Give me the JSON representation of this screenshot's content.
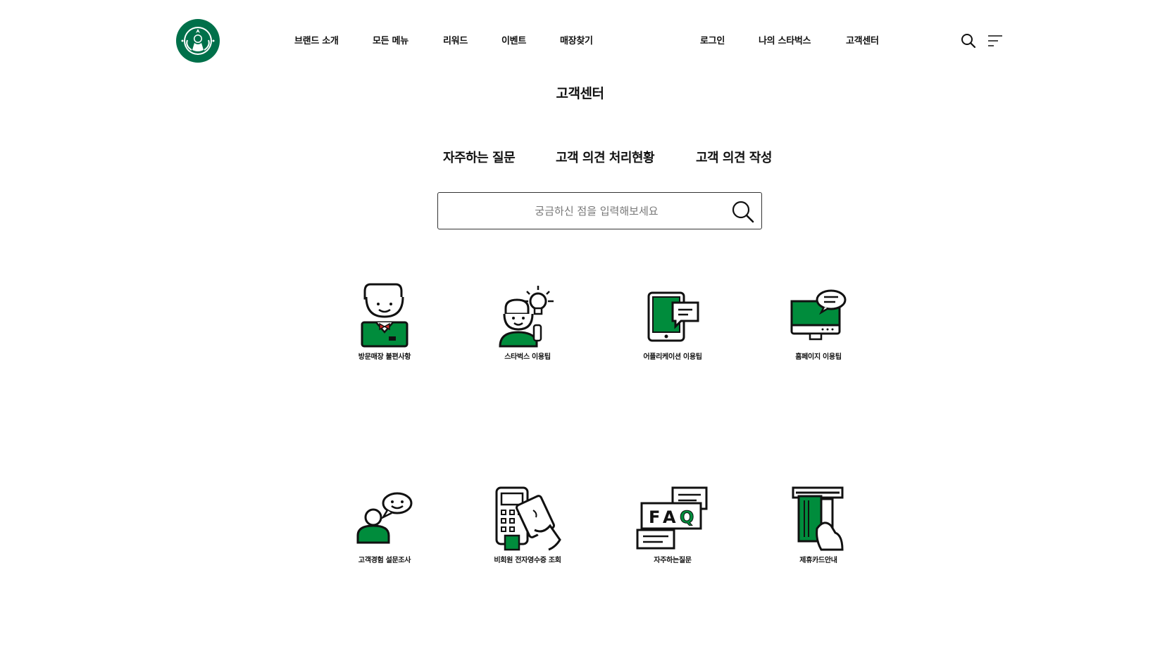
{
  "brand": {
    "logo_icon": "starbucks-siren-logo",
    "color": "#00704a"
  },
  "nav": {
    "left": [
      {
        "label": "브랜드 소개"
      },
      {
        "label": "모든 메뉴"
      },
      {
        "label": "리워드"
      },
      {
        "label": "이벤트"
      },
      {
        "label": "매장찾기"
      }
    ],
    "right": [
      {
        "label": "로그인"
      },
      {
        "label": "나의 스타벅스"
      },
      {
        "label": "고객센터"
      }
    ],
    "icons": [
      "search-icon",
      "menu-icon"
    ]
  },
  "page": {
    "title": "고객센터"
  },
  "tabs": [
    {
      "label": "자주하는 질문"
    },
    {
      "label": "고객 의견 처리현황"
    },
    {
      "label": "고객 의견 작성"
    }
  ],
  "search": {
    "placeholder": "궁금하신 점을 입력해보세요",
    "value": ""
  },
  "categories": [
    {
      "label": "방문매장 불편사항",
      "icon": "barista-icon"
    },
    {
      "label": "스타벅스 이용팁",
      "icon": "idea-barista-icon"
    },
    {
      "label": "어플리케이션 이용팁",
      "icon": "tablet-chat-icon"
    },
    {
      "label": "홈페이지 이용팁",
      "icon": "monitor-chat-icon"
    },
    {
      "label": "고객경험 설문조사",
      "icon": "survey-chat-icon"
    },
    {
      "label": "비회원 전자영수증 조회",
      "icon": "card-payment-icon"
    },
    {
      "label": "자주하는질문",
      "icon": "faq-icon"
    },
    {
      "label": "제휴카드안내",
      "icon": "card-insert-icon"
    }
  ],
  "colors": {
    "accent": "#008c3c",
    "text": "#111111",
    "border": "#333333",
    "bowtie": "#d22b2b"
  }
}
